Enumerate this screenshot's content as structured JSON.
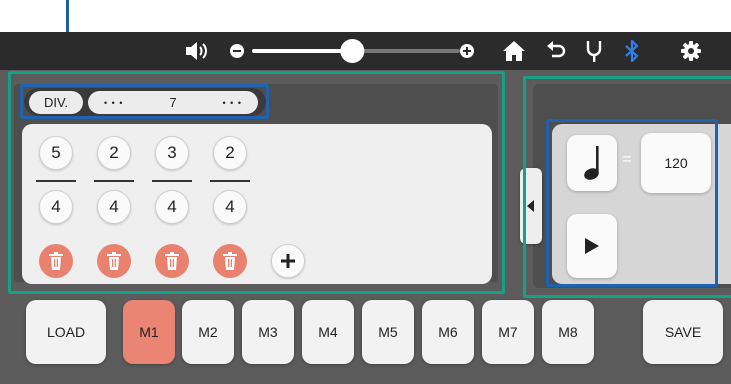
{
  "app": {
    "accent_color": "#ea8473",
    "bluetooth_color": "#2f80ed"
  },
  "topbar": {
    "volume": 0.48,
    "icons": [
      "speaker-icon",
      "volume-decrease-icon",
      "volume-increase-icon",
      "home-icon",
      "undo-icon",
      "tuning-fork-icon",
      "bluetooth-icon",
      "gear-icon"
    ]
  },
  "division": {
    "label": "DIV.",
    "value": "7",
    "decrement": "• • •",
    "increment": "• • •"
  },
  "time_signatures": [
    {
      "top": "5",
      "bottom": "4"
    },
    {
      "top": "2",
      "bottom": "4"
    },
    {
      "top": "3",
      "bottom": "4"
    },
    {
      "top": "2",
      "bottom": "4"
    }
  ],
  "tempo": {
    "equals": "=",
    "bpm": "120"
  },
  "bottom": {
    "load": "LOAD",
    "save": "SAVE",
    "memories": [
      "M1",
      "M2",
      "M3",
      "M4",
      "M5",
      "M6",
      "M7",
      "M8"
    ],
    "active_memory": "M1"
  }
}
